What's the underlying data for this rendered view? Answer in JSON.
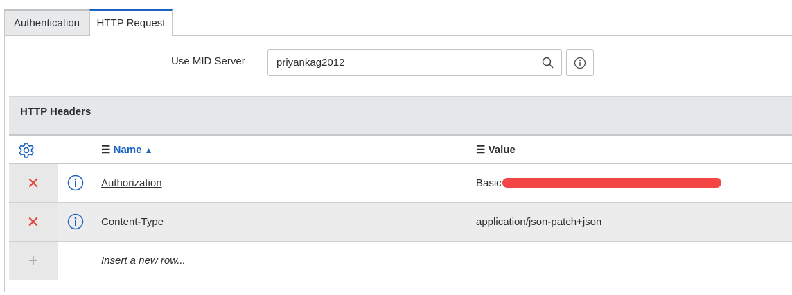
{
  "tabs": [
    {
      "label": "Authentication"
    },
    {
      "label": "HTTP Request"
    }
  ],
  "mid_server": {
    "label": "Use MID Server",
    "value": "priyankag2012"
  },
  "section": {
    "title": "HTTP Headers"
  },
  "columns": {
    "name": "Name",
    "value": "Value"
  },
  "rows": [
    {
      "name": "Authorization",
      "value": "Basic"
    },
    {
      "name": "Content-Type",
      "value": "application/json-patch+json"
    }
  ],
  "insert_row": "Insert a new row...",
  "colors": {
    "accent": "#1a62c4",
    "delete": "#e0463a",
    "redaction": "#f44545"
  }
}
